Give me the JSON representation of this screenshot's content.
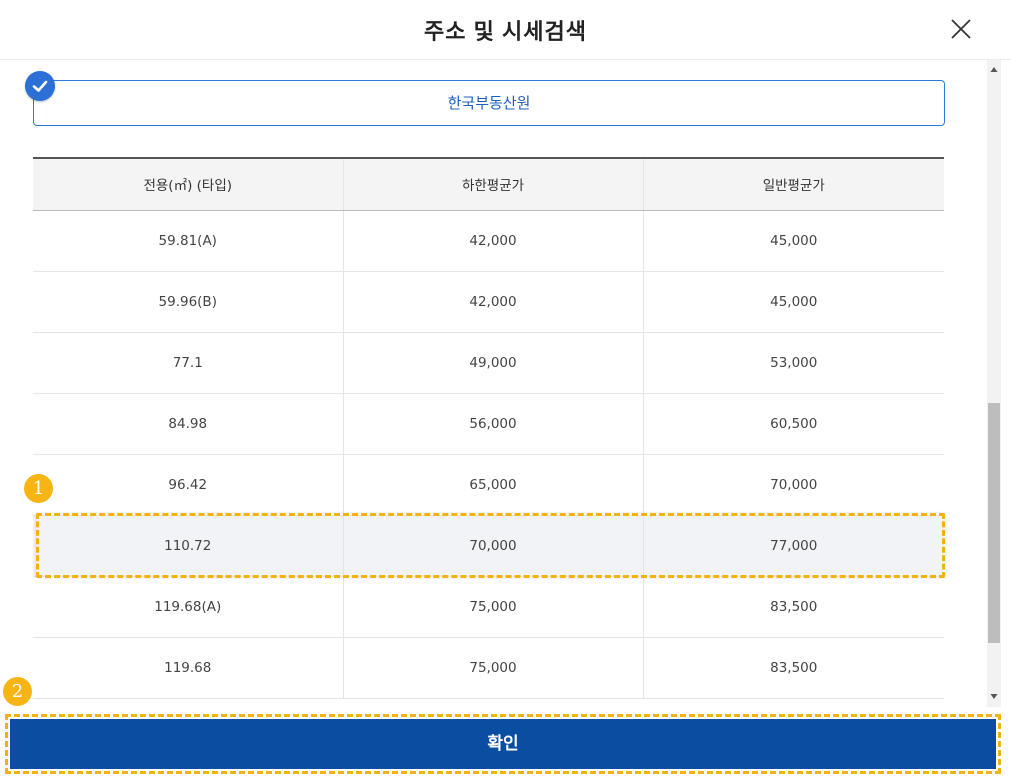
{
  "dialog": {
    "title": "주소 및 시세검색",
    "close_icon": "close-icon"
  },
  "source": {
    "label": "한국부동산원",
    "checked": true,
    "accent_color": "#2c6fd6"
  },
  "table": {
    "headers": [
      "전용(㎡) (타입)",
      "하한평균가",
      "일반평균가"
    ],
    "rows": [
      [
        "59.81(A)",
        "42,000",
        "45,000"
      ],
      [
        "59.96(B)",
        "42,000",
        "45,000"
      ],
      [
        "77.1",
        "49,000",
        "53,000"
      ],
      [
        "84.98",
        "56,000",
        "60,500"
      ],
      [
        "96.42",
        "65,000",
        "70,000"
      ],
      [
        "110.72",
        "70,000",
        "77,000"
      ],
      [
        "119.68(A)",
        "75,000",
        "83,500"
      ],
      [
        "119.68",
        "75,000",
        "83,500"
      ]
    ],
    "selected_row": 5
  },
  "annotations": {
    "badge1": "1",
    "badge2": "2",
    "highlight_color": "#f2b30f"
  },
  "footer": {
    "confirm_label": "확인",
    "button_color": "#0a4ea2"
  }
}
